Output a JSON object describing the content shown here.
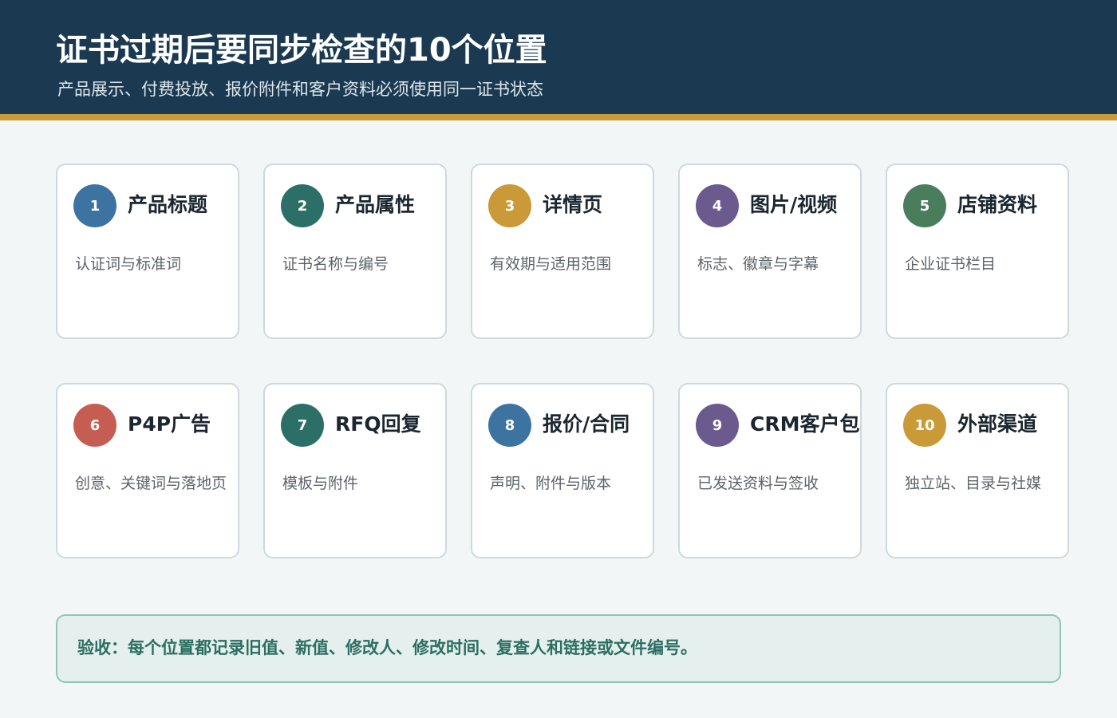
{
  "header": {
    "title": "证书过期后要同步检查的10个位置",
    "subtitle": "产品展示、付费投放、报价附件和客户资料必须使用同一证书状态"
  },
  "colors": {
    "header_bg": "#1b3a52",
    "accent_bar": "#c99a37",
    "blue": "#3c73a0",
    "teal": "#2c6f66",
    "gold": "#c99a37",
    "purple": "#6a5a8e",
    "green": "#4a7d5c",
    "red": "#c65d52"
  },
  "cards": [
    {
      "num": "1",
      "title": "产品标题",
      "desc": "认证词与标准词",
      "color": "#3c73a0"
    },
    {
      "num": "2",
      "title": "产品属性",
      "desc": "证书名称与编号",
      "color": "#2c6f66"
    },
    {
      "num": "3",
      "title": "详情页",
      "desc": "有效期与适用范围",
      "color": "#c99a37"
    },
    {
      "num": "4",
      "title": "图片/视频",
      "desc": "标志、徽章与字幕",
      "color": "#6a5a8e"
    },
    {
      "num": "5",
      "title": "店铺资料",
      "desc": "企业证书栏目",
      "color": "#4a7d5c"
    },
    {
      "num": "6",
      "title": "P4P广告",
      "desc": "创意、关键词与落地页",
      "color": "#c65d52"
    },
    {
      "num": "7",
      "title": "RFQ回复",
      "desc": "模板与附件",
      "color": "#2c6f66"
    },
    {
      "num": "8",
      "title": "报价/合同",
      "desc": "声明、附件与版本",
      "color": "#3c73a0"
    },
    {
      "num": "9",
      "title": "CRM客户包",
      "desc": "已发送资料与签收",
      "color": "#6a5a8e"
    },
    {
      "num": "10",
      "title": "外部渠道",
      "desc": "独立站、目录与社媒",
      "color": "#c99a37"
    }
  ],
  "note": {
    "text": "验收：每个位置都记录旧值、新值、修改人、修改时间、复查人和链接或文件编号。"
  }
}
